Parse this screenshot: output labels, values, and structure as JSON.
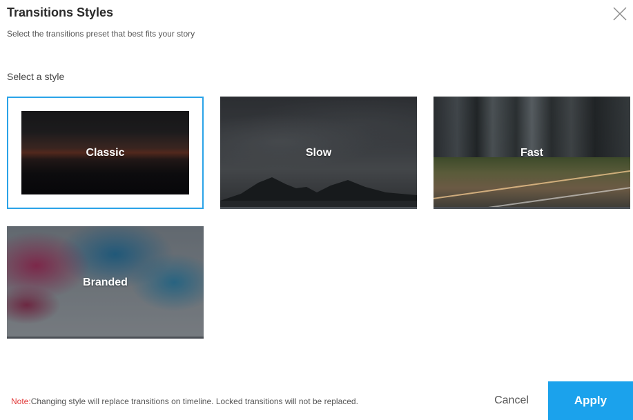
{
  "dialog": {
    "title": "Transitions Styles",
    "subtitle": "Select the transitions preset that best fits your story",
    "section_label": "Select a style"
  },
  "styles": [
    {
      "label": "Classic",
      "selected": true
    },
    {
      "label": "Slow",
      "selected": false
    },
    {
      "label": "Fast",
      "selected": false
    },
    {
      "label": "Branded",
      "selected": false
    }
  ],
  "footer": {
    "note_prefix": "Note:",
    "note_text": "Changing style will replace transitions on timeline. Locked transitions will not be replaced.",
    "cancel_label": "Cancel",
    "apply_label": "Apply"
  },
  "colors": {
    "accent": "#1ba2ec",
    "selected_border": "#2aa3e8",
    "note_prefix": "#e23a3a"
  },
  "icons": {
    "close": "close-icon"
  }
}
